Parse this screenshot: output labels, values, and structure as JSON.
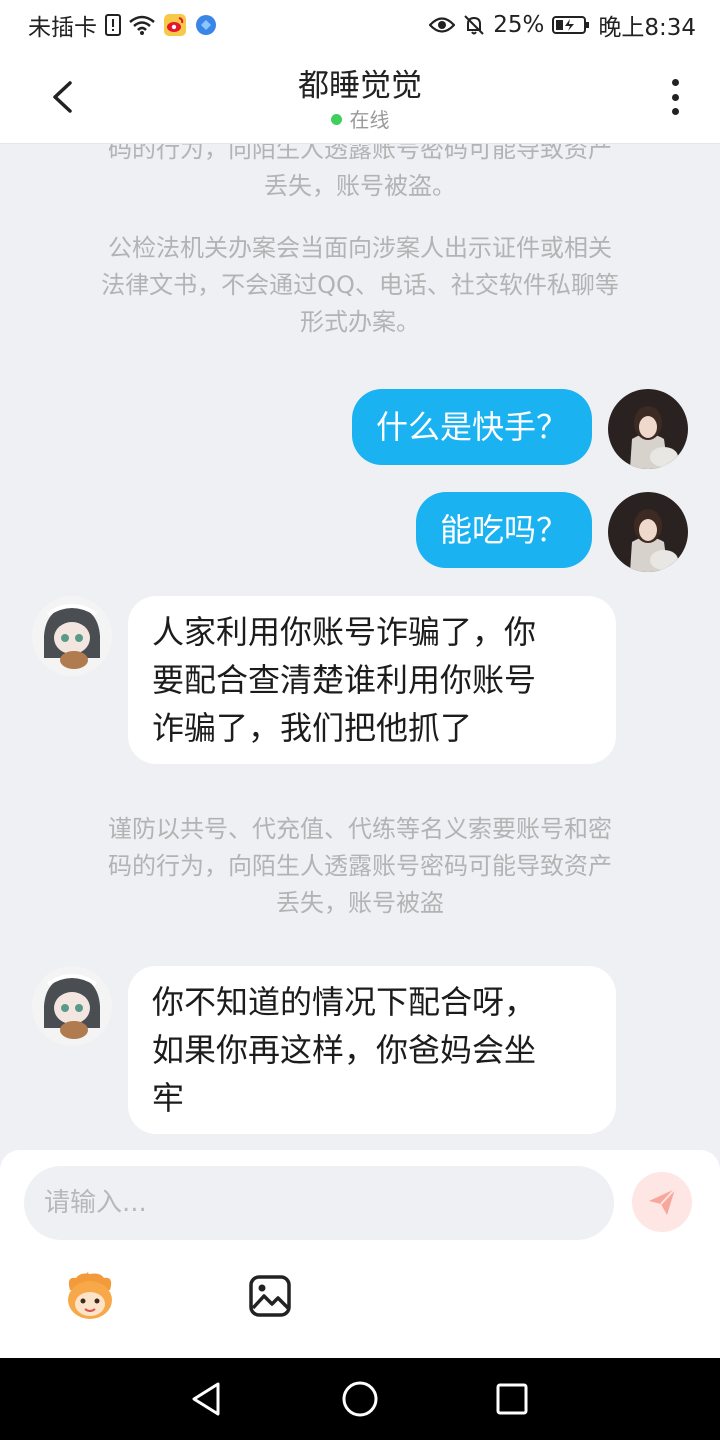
{
  "status_bar": {
    "carrier": "未插卡",
    "battery_percent": "25%",
    "time": "晚上8:34"
  },
  "header": {
    "title": "都睡觉觉",
    "status": "在线"
  },
  "chat": {
    "notice_top": [
      "码的行为，向陌生人透露账号密码可能导致资产",
      "丢失，账号被盗。"
    ],
    "notice_law": [
      "公检法机关办案会当面向涉案人出示证件或相关",
      "法律文书，不会通过QQ、电话、社交软件私聊等",
      "形式办案。"
    ],
    "messages": [
      {
        "side": "out",
        "text": "什么是快手？"
      },
      {
        "side": "out",
        "text": "能吃吗？"
      },
      {
        "side": "in",
        "lines": [
          "人家利用你账号诈骗了，你",
          "要配合查清楚谁利用你账号",
          "诈骗了，我们把他抓了"
        ]
      },
      {
        "side": "in",
        "lines": [
          "你不知道的情况下配合呀，",
          "如果你再这样，你爸妈会坐",
          "牢"
        ]
      }
    ],
    "notice_fraud": [
      "谨防以共号、代充值、代练等名义索要账号和密",
      "码的行为，向陌生人透露账号密码可能导致资产",
      "丢失，账号被盗"
    ]
  },
  "input_bar": {
    "placeholder": "请输入..."
  },
  "icons": {
    "back": "chevron-left-icon",
    "more": "more-vertical-icon",
    "send": "paper-plane-icon",
    "emoji": "cartoon-face-icon",
    "image": "image-icon",
    "nav_back": "triangle-back-icon",
    "nav_home": "circle-home-icon",
    "nav_recent": "square-recent-icon"
  },
  "colors": {
    "outgoing_bubble": "#1ab2f1",
    "incoming_bubble": "#ffffff",
    "chat_background": "#eef0f4",
    "online_dot": "#3fcf5c",
    "send_button": "#fde6e3"
  }
}
